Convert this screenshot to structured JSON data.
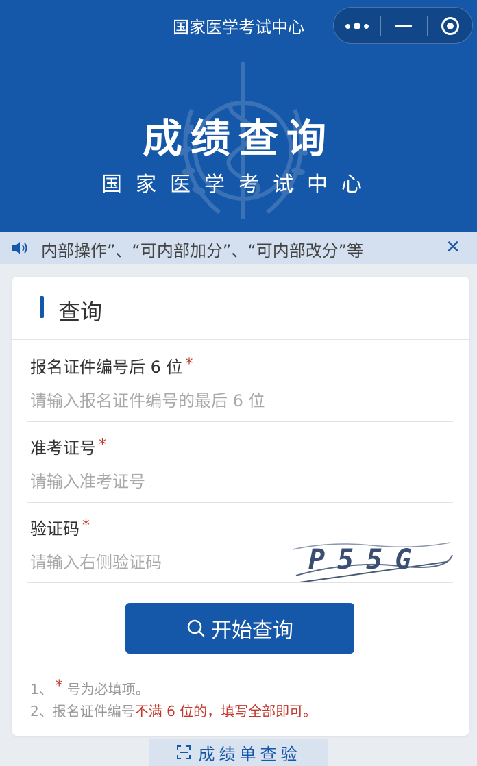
{
  "app": {
    "title": "国家医学考试中心"
  },
  "hero": {
    "title": "成绩查询",
    "subtitle": "国家医学考试中心"
  },
  "notice": {
    "text": "内部操作”、“可内部加分”、“可内部改分”等"
  },
  "card": {
    "title": "查询",
    "fields": [
      {
        "label": "报名证件编号后 6 位",
        "required_mark": "*",
        "placeholder": "请输入报名证件编号的最后 6 位",
        "value": ""
      },
      {
        "label": "准考证号",
        "required_mark": "*",
        "placeholder": "请输入准考证号",
        "value": ""
      },
      {
        "label": "验证码",
        "required_mark": "*",
        "placeholder": "请输入右侧验证码",
        "value": ""
      }
    ],
    "captcha_text": "P55G",
    "submit_label": "开始查询",
    "notes": {
      "line1_prefix": "1、",
      "line1_star": "*",
      "line1_suffix": "号为必填项。",
      "line2_prefix": "2、报名证件编号",
      "line2_red": "不满 6 位的，填写全部即可。"
    }
  },
  "bottom_tab": {
    "label": "成绩单查验"
  },
  "colors": {
    "primary": "#1557a8",
    "required": "#c0392b",
    "notice_bg": "#d4dff0",
    "page_bg": "#e9ecf1"
  },
  "icons": {
    "more": "more-dots-icon",
    "minimize": "minimize-icon",
    "close_app": "target-icon",
    "speaker": "speaker-icon",
    "close_notice": "close-icon",
    "search": "search-icon",
    "scan": "scan-icon"
  }
}
